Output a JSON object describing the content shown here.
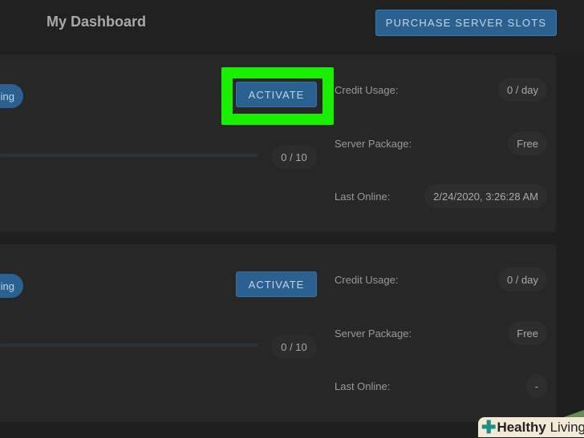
{
  "header": {
    "title": "My Dashboard",
    "purchase_label": "PURCHASE SERVER SLOTS"
  },
  "servers": [
    {
      "status": "ing",
      "activate_label": "ACTIVATE",
      "highlighted": true,
      "players": "0 / 10",
      "player_fraction": 0,
      "credit_label": "Credit Usage:",
      "credit": "0 / day",
      "package_label": "Server Package:",
      "package": "Free",
      "online_label": "Last Online:",
      "last_online": "2/24/2020, 3:26:28 AM"
    },
    {
      "status": "ing",
      "activate_label": "ACTIVATE",
      "highlighted": false,
      "players": "0 / 10",
      "player_fraction": 0,
      "credit_label": "Credit Usage:",
      "credit": "0 / day",
      "package_label": "Server Package:",
      "package": "Free",
      "online_label": "Last Online:",
      "last_online": "-"
    }
  ],
  "watermark": {
    "bold": "Healthy",
    "rest": " Living"
  },
  "colors": {
    "accent": "#2a6191",
    "highlight": "#19f000"
  }
}
